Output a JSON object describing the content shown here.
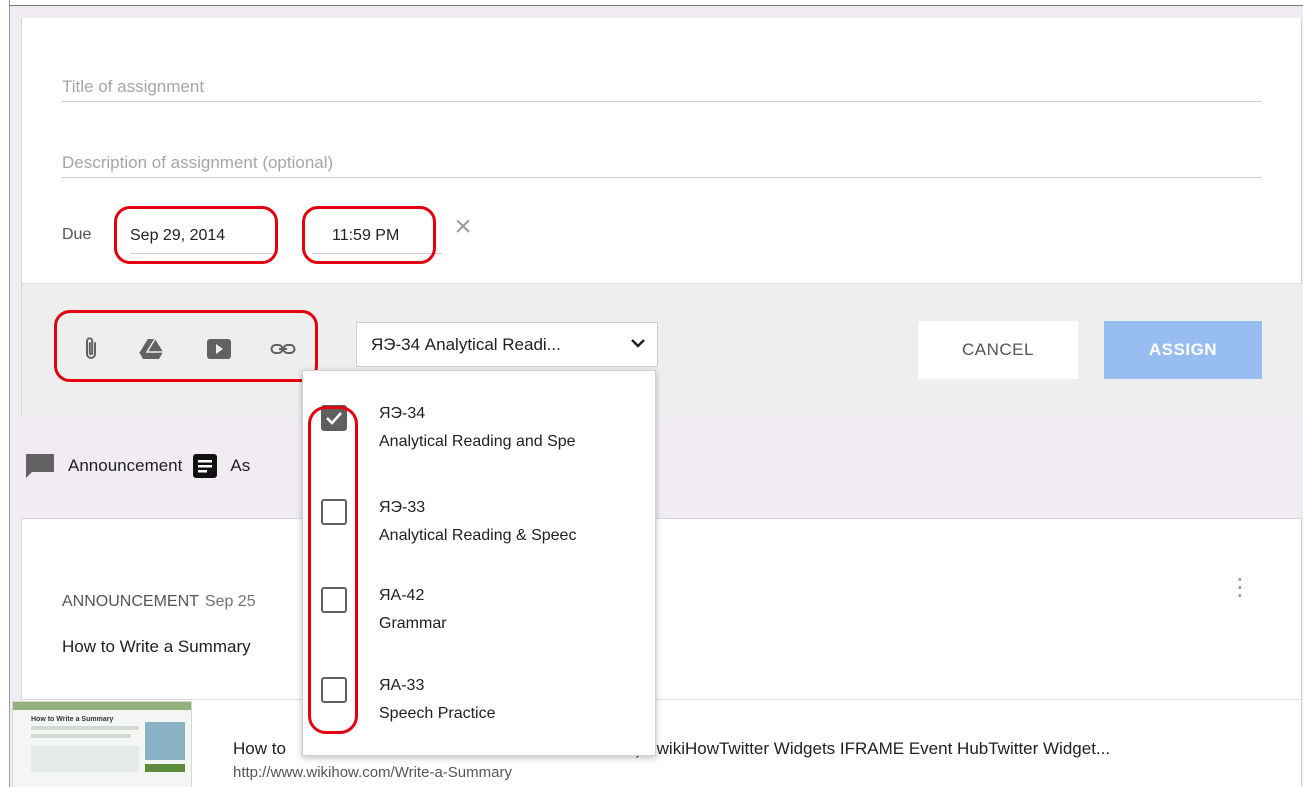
{
  "composer": {
    "title_placeholder": "Title of assignment",
    "description_placeholder": "Description of assignment (optional)",
    "due_label": "Due",
    "due_date": "Sep 29, 2014",
    "due_time": "11:59 PM",
    "class_select_label": "ЯЭ-34 Analytical Readi...",
    "cancel_label": "CANCEL",
    "assign_label": "ASSIGN"
  },
  "attach_icons": [
    "paperclip-icon",
    "drive-icon",
    "youtube-icon",
    "link-icon"
  ],
  "class_menu": {
    "items": [
      {
        "code": "ЯЭ-34",
        "name": "Analytical Reading and Spe",
        "checked": true
      },
      {
        "code": "ЯЭ-33",
        "name": "Analytical Reading & Speec",
        "checked": false
      },
      {
        "code": "ЯА-42",
        "name": "Grammar",
        "checked": false
      },
      {
        "code": "ЯА-33",
        "name": "Speech Practice",
        "checked": false
      }
    ]
  },
  "post_types": {
    "announcement": "Announcement",
    "assignment": "As"
  },
  "stream": {
    "post_label": "ANNOUNCEMENT",
    "post_date": "Sep 25",
    "post_title": "How to Write a Summary",
    "link_title_left": "How to",
    "link_title_right": "es) - wikiHowTwitter Widgets IFRAME Event HubTwitter Widget...",
    "link_url": "http://www.wikihow.com/Write-a-Summary",
    "thumbnail_title": "How to Write a Summary"
  },
  "colors": {
    "annotation_red": "#e3000f",
    "assign_button": "#98bdf0",
    "page_background": "#f1ecf4"
  }
}
